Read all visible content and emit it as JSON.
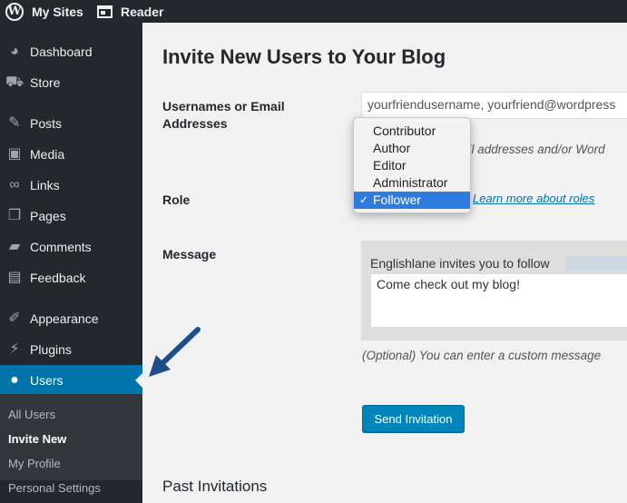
{
  "adminbar": {
    "my_sites": "My Sites",
    "reader": "Reader"
  },
  "sidebar": {
    "items": [
      {
        "label": "Dashboard",
        "icon": "dashboard-icon"
      },
      {
        "label": "Store",
        "icon": "cart-icon"
      },
      {
        "label": "Posts",
        "icon": "pushpin-icon"
      },
      {
        "label": "Media",
        "icon": "media-icon"
      },
      {
        "label": "Links",
        "icon": "link-icon"
      },
      {
        "label": "Pages",
        "icon": "pages-icon"
      },
      {
        "label": "Comments",
        "icon": "comment-icon"
      },
      {
        "label": "Feedback",
        "icon": "feedback-icon"
      },
      {
        "label": "Appearance",
        "icon": "brush-icon"
      },
      {
        "label": "Plugins",
        "icon": "plugin-icon"
      },
      {
        "label": "Users",
        "icon": "user-icon"
      }
    ],
    "submenu": [
      "All Users",
      "Invite New",
      "My Profile",
      "Personal Settings"
    ]
  },
  "main": {
    "title": "Invite New Users to Your Blog",
    "usernames_label": "Usernames or Email Addresses",
    "usernames_value": "yourfriendusername, yourfriend@wordpress",
    "usernames_desc": "ail addresses and/or Word",
    "role_label": "Role",
    "role_link": "Learn more about roles",
    "role_options": [
      "Contributor",
      "Author",
      "Editor",
      "Administrator",
      "Follower"
    ],
    "role_selected": "Follower",
    "message_label": "Message",
    "message_intro": "Englishlane invites you to follow",
    "message_value": "Come check out my blog!",
    "message_desc": "(Optional) You can enter a custom message",
    "send_button": "Send Invitation",
    "past_title": "Past Invitations"
  },
  "colors": {
    "adminbar": "#23282d",
    "active": "#0073aa",
    "selected_option": "#2f7ce0",
    "button": "#0085ba",
    "arrow": "#1f4d8c"
  }
}
